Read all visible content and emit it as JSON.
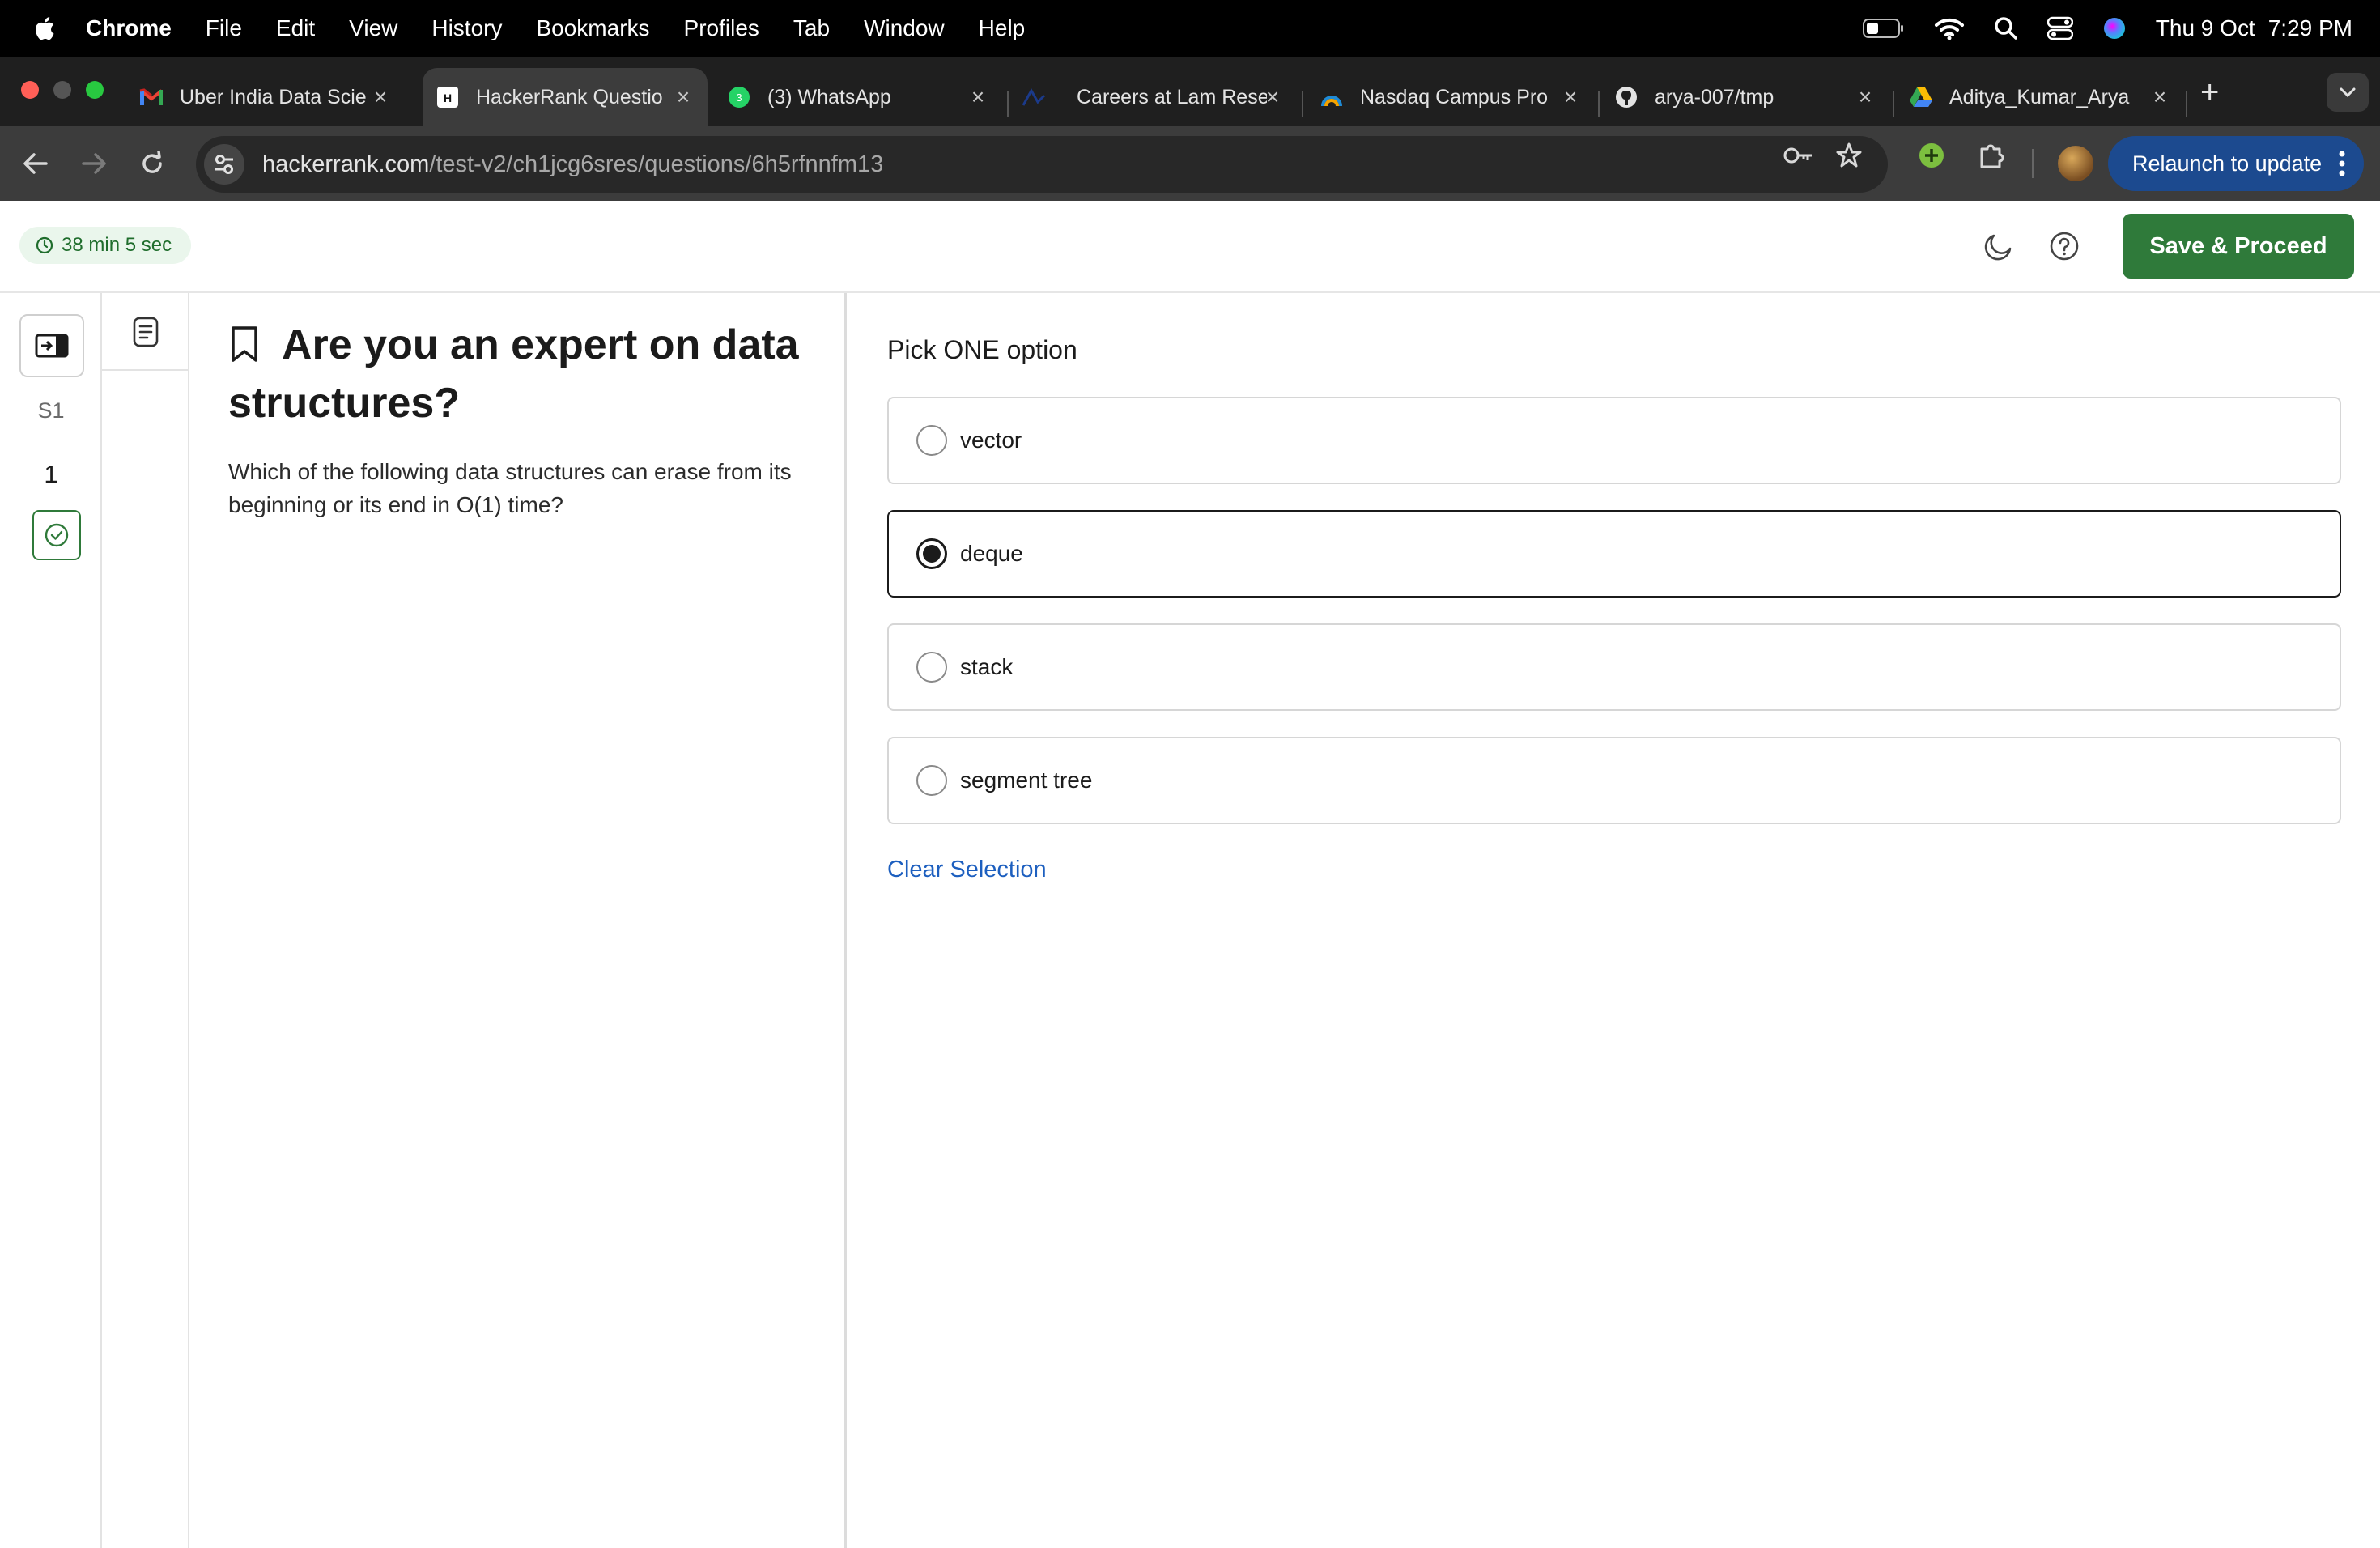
{
  "menubar": {
    "app": "Chrome",
    "items": [
      "File",
      "Edit",
      "View",
      "History",
      "Bookmarks",
      "Profiles",
      "Tab",
      "Window",
      "Help"
    ],
    "date": "Thu 9 Oct",
    "time": "7:29 PM"
  },
  "tabs": [
    {
      "title": "Uber India Data Scie",
      "icon": "gmail-icon",
      "active": false
    },
    {
      "title": "HackerRank Questio",
      "icon": "hackerrank-icon",
      "active": true
    },
    {
      "title": "(3) WhatsApp",
      "icon": "whatsapp-icon",
      "badge": "3",
      "active": false
    },
    {
      "title": "Careers at Lam Rese",
      "icon": "lam-research-icon",
      "active": false
    },
    {
      "title": "Nasdaq Campus Pro",
      "icon": "nasdaq-icon",
      "active": false
    },
    {
      "title": "arya-007/tmp",
      "icon": "github-icon",
      "active": false
    },
    {
      "title": "Aditya_Kumar_Arya",
      "icon": "google-drive-icon",
      "active": false
    }
  ],
  "toolbar": {
    "url_host": "hackerrank.com",
    "url_path": "/test-v2/ch1jcg6sres/questions/6h5rfnnfm13",
    "relaunch_label": "Relaunch to update"
  },
  "header": {
    "timer": "38 min 5 sec",
    "save_label": "Save & Proceed"
  },
  "rail": {
    "section": "S1",
    "question_number": "1"
  },
  "question": {
    "title": "Are you an expert on data structures?",
    "body": "Which of the following data structures can erase from its beginning or its end in O(1) time?"
  },
  "answer": {
    "instruction": "Pick ONE option",
    "options": [
      {
        "label": "vector",
        "selected": false
      },
      {
        "label": "deque",
        "selected": true
      },
      {
        "label": "stack",
        "selected": false
      },
      {
        "label": "segment tree",
        "selected": false
      }
    ],
    "clear_label": "Clear Selection"
  },
  "colors": {
    "brand_green": "#2f7a3a",
    "link_blue": "#1d5fbf",
    "timer_bg": "#eaf6ec",
    "relaunch_blue": "#1c4a8f"
  }
}
